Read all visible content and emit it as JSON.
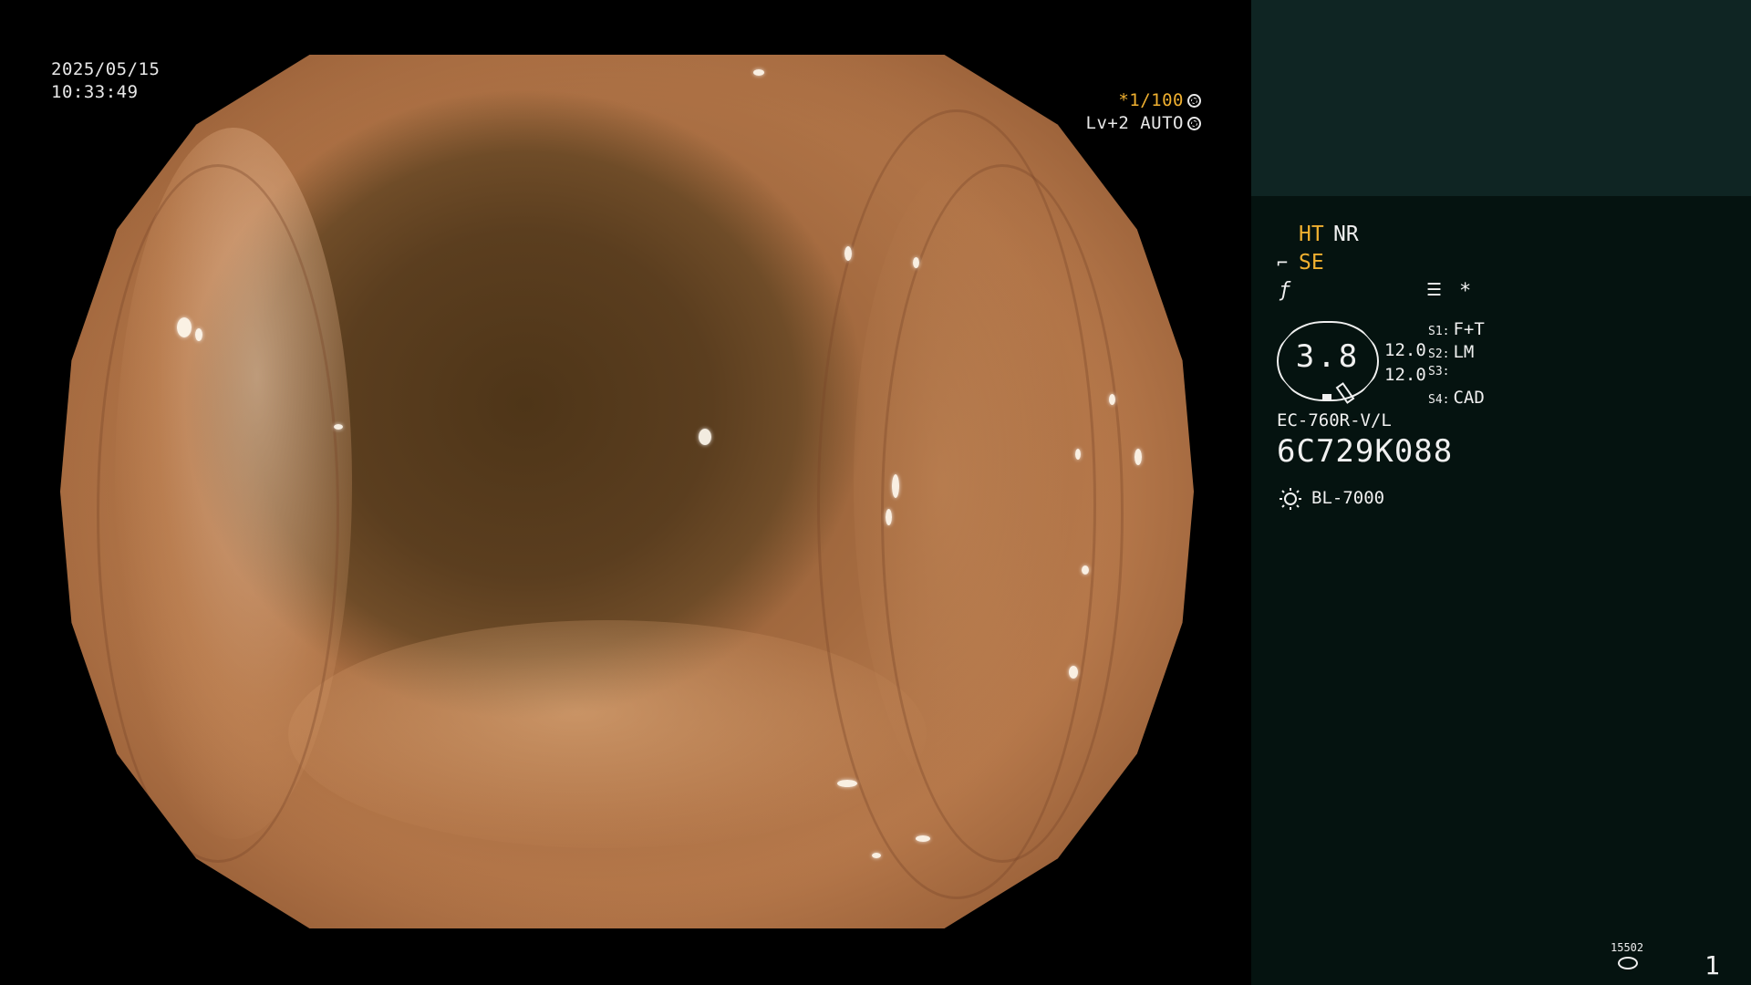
{
  "overlay": {
    "date": "2025/05/15",
    "time": "10:33:49",
    "shutter_speed": "*1/100",
    "exposure": "Lv+2 AUTO"
  },
  "panel": {
    "mode_ht": "HT",
    "mode_nr": "NR",
    "mode_se": "SE",
    "gauge_value": "3.8",
    "gauge_num1": "12.0",
    "gauge_num2": "12.0",
    "settings": [
      {
        "key": "S1:",
        "value": "F+T"
      },
      {
        "key": "S2:",
        "value": "LM"
      },
      {
        "key": "S3:",
        "value": ""
      },
      {
        "key": "S4:",
        "value": "CAD"
      }
    ],
    "scope_model": "EC-760R-V/L",
    "scope_serial": "6C729K088",
    "light_source": "BL-7000",
    "storage_code": "15502",
    "page_number": "1"
  },
  "colors": {
    "accent": "#f0b030",
    "panel_bg": "#051310",
    "panel_top_bg": "#0f2523",
    "text": "#f0f0f0"
  }
}
